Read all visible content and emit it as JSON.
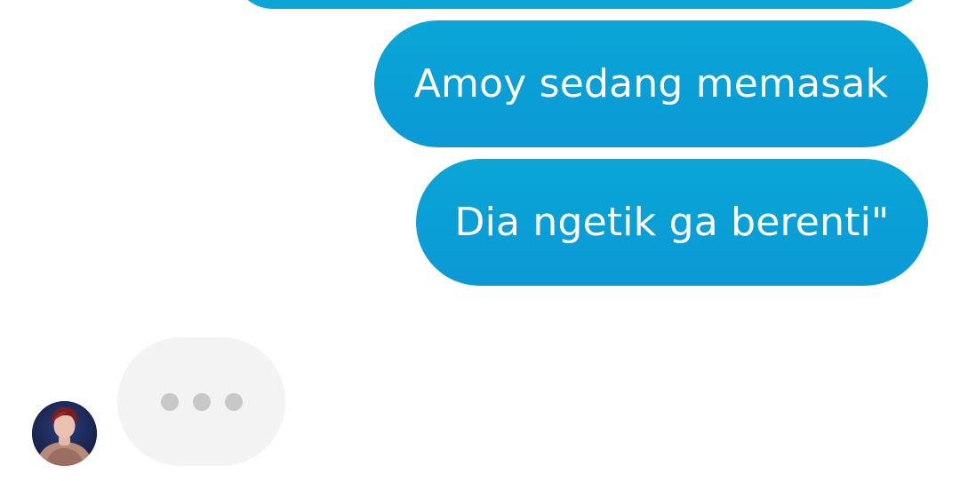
{
  "conversation": {
    "messages_out": [
      {
        "text": ""
      },
      {
        "text": "Amoy sedang memasak"
      },
      {
        "text": "Dia ngetik ga berenti\""
      }
    ],
    "typing_indicator": {
      "dots": 3
    }
  },
  "colors": {
    "outgoing_bubble": "#0aa6d6",
    "incoming_bubble": "#f3f3f3",
    "typing_dot": "#c8c8c8",
    "background": "#ffffff"
  },
  "icons": {
    "avatar": "contact-avatar"
  }
}
